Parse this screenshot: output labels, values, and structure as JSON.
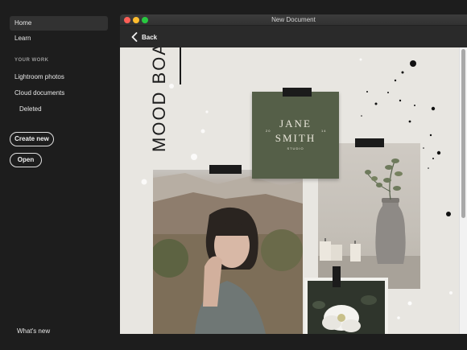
{
  "sidebar": {
    "home": "Home",
    "learn": "Learn",
    "section_label": "YOUR WORK",
    "lightroom": "Lightroom photos",
    "cloud_docs": "Cloud documents",
    "deleted": "Deleted",
    "create_new": "Create new",
    "open": "Open",
    "whats_new": "What's new"
  },
  "window": {
    "title": "New Document",
    "back_label": "Back",
    "traffic_colors": [
      "#fe5f57",
      "#febc2e",
      "#28c840"
    ]
  },
  "canvas": {
    "title": "MOOD BOARD",
    "logo": {
      "line1": "JANE",
      "line2": "SMITH",
      "left_num": "20",
      "right_num": "14",
      "tagline": "STUDIO"
    },
    "card_color": "#555f48"
  }
}
